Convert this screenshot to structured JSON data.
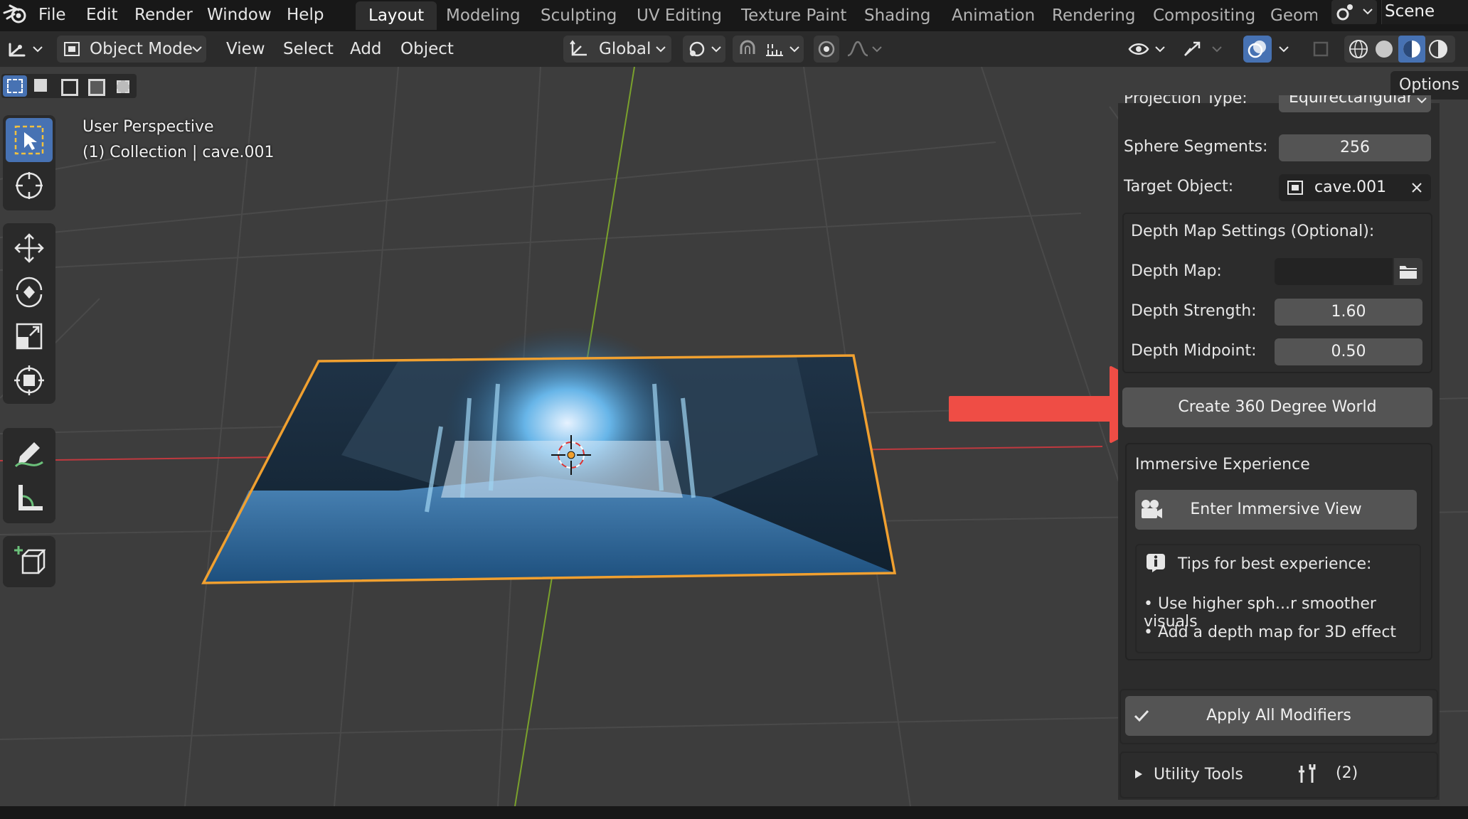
{
  "menu": {
    "items": [
      "File",
      "Edit",
      "Render",
      "Window",
      "Help"
    ]
  },
  "workspace_tabs": [
    "Layout",
    "Modeling",
    "Sculpting",
    "UV Editing",
    "Texture Paint",
    "Shading",
    "Animation",
    "Rendering",
    "Compositing",
    "Geom"
  ],
  "scene": {
    "label": "Scene"
  },
  "header": {
    "mode": "Object Mode",
    "menus": [
      "View",
      "Select",
      "Add",
      "Object"
    ],
    "orientation": "Global",
    "options_label": "Options"
  },
  "viewport": {
    "perspective_label": "User Perspective",
    "collection_label": "(1) Collection | cave.001"
  },
  "panel": {
    "projection_type_label": "Projection Type:",
    "projection_type_value": "Equirectangular",
    "sphere_segments_label": "Sphere Segments:",
    "sphere_segments_value": "256",
    "target_object_label": "Target Object:",
    "target_object_value": "cave.001",
    "depth_settings_title": "Depth Map Settings (Optional):",
    "depth_map_label": "Depth Map:",
    "depth_map_value": "",
    "depth_strength_label": "Depth Strength:",
    "depth_strength_value": "1.60",
    "depth_midpoint_label": "Depth Midpoint:",
    "depth_midpoint_value": "0.50",
    "create_button": "Create 360 Degree World",
    "immersive_title": "Immersive Experience",
    "enter_immersive_button": "Enter Immersive View",
    "tips_title": "Tips for best experience:",
    "tips": [
      "• Use higher sph...r smoother visuals",
      "• Add a depth map for 3D effect"
    ],
    "apply_modifiers_button": "Apply All Modifiers",
    "utility_tools_label": "Utility Tools",
    "utility_tools_count": "(2)"
  },
  "colors": {
    "accent": "#4772b3",
    "selection_outline": "#f0a030",
    "arrow": "#ef4d45",
    "x_axis": "#c0393f",
    "y_axis": "#7aa12c"
  }
}
